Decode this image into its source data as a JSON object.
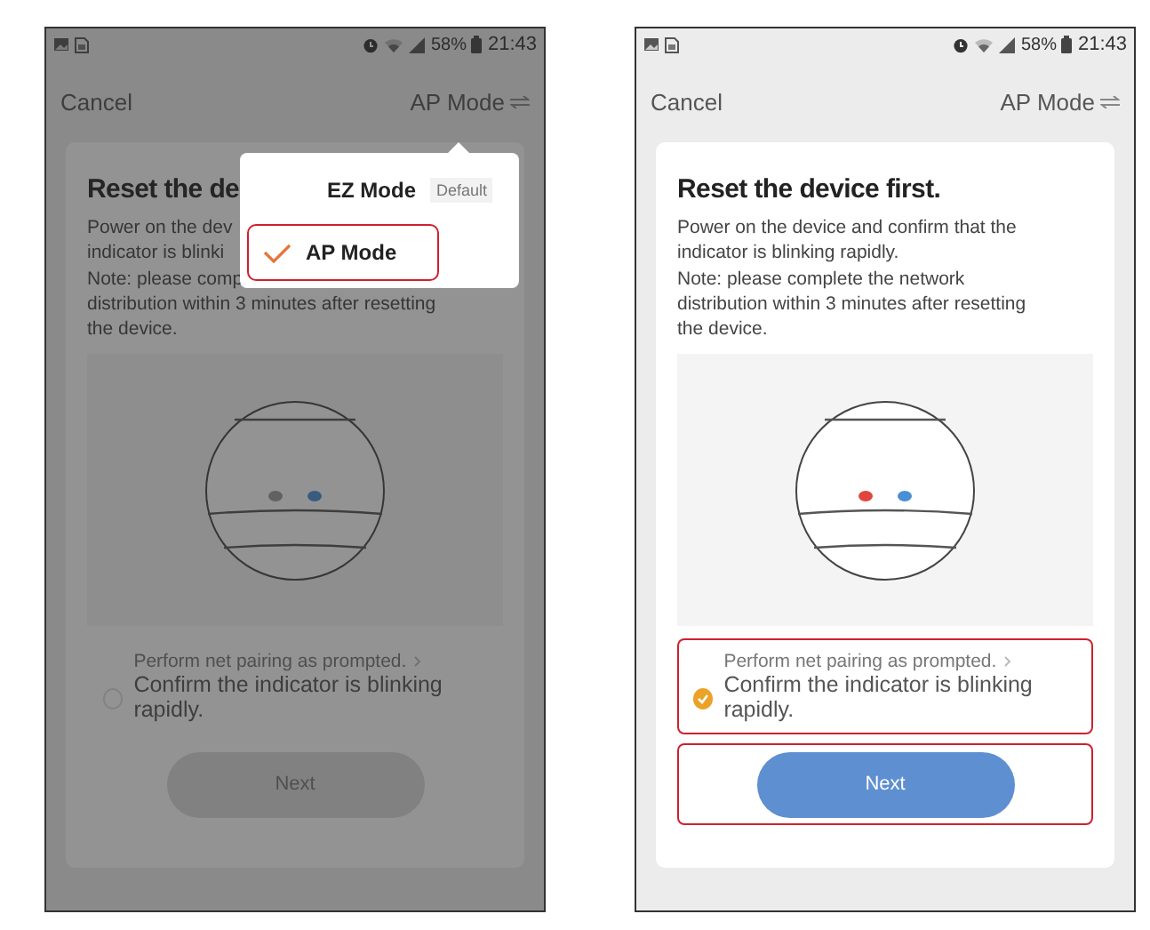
{
  "screens": [
    {
      "dimmed": true,
      "status_bar": {
        "battery": "58%",
        "time": "21:43"
      },
      "header": {
        "cancel": "Cancel",
        "mode": "AP Mode"
      },
      "card": {
        "title": "Reset the de",
        "body_lines": [
          "Power on the dev",
          "indicator is blinki",
          "Note: please comp",
          "distribution within 3 minutes after resetting",
          "the device."
        ],
        "red_light_on": false,
        "confirm": {
          "hint": "Perform net pairing as prompted.",
          "text": "Confirm the indicator is blinking rapidly.",
          "checked": false,
          "highlighted": false
        },
        "next_button": {
          "label": "Next",
          "highlighted": false
        }
      },
      "menu": {
        "items": [
          {
            "label": "EZ Mode",
            "badge": "Default",
            "selected": false,
            "highlighted": false
          },
          {
            "label": "AP Mode",
            "selected": true,
            "highlighted": true
          }
        ]
      }
    },
    {
      "dimmed": false,
      "status_bar": {
        "battery": "58%",
        "time": "21:43"
      },
      "header": {
        "cancel": "Cancel",
        "mode": "AP Mode"
      },
      "card": {
        "title": "Reset the device first.",
        "body_lines": [
          "Power on the device and confirm that the",
          "indicator is blinking rapidly.",
          "Note: please complete the network",
          "distribution within 3 minutes after resetting",
          "the device."
        ],
        "red_light_on": true,
        "confirm": {
          "hint": "Perform net pairing as prompted.",
          "text": "Confirm the indicator is blinking rapidly.",
          "checked": true,
          "highlighted": true
        },
        "next_button": {
          "label": "Next",
          "highlighted": true
        }
      }
    }
  ]
}
